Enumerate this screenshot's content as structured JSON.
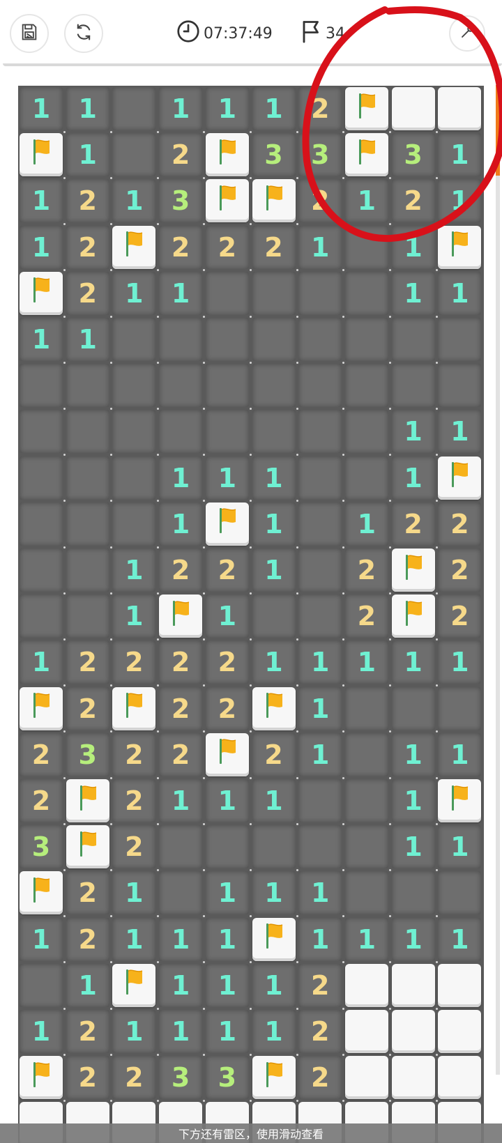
{
  "toolbar": {
    "timer": "07:37:49",
    "flag_count": "34",
    "icons": [
      "save-icon",
      "restart-icon",
      "clock-icon",
      "flag-icon",
      "tool-icon"
    ]
  },
  "colors": {
    "one": "#6ff0d2",
    "two": "#f6d98a",
    "three": "#b6ee7c",
    "flag": "#f7b21b",
    "accent": "#f07a1a",
    "annotation": "#d8111a"
  },
  "board": {
    "rows": [
      [
        "1",
        "1",
        "",
        "1",
        "1",
        "1",
        "2",
        "F",
        "C",
        "C"
      ],
      [
        "F",
        "1",
        "",
        "2",
        "F",
        "3",
        "3",
        "F",
        "3",
        "1"
      ],
      [
        "1",
        "2",
        "1",
        "3",
        "F",
        "F",
        "2",
        "1",
        "2",
        "1"
      ],
      [
        "1",
        "2",
        "F",
        "2",
        "2",
        "2",
        "1",
        "",
        "1",
        "F"
      ],
      [
        "F",
        "2",
        "1",
        "1",
        "",
        "",
        "",
        "",
        "1",
        "1"
      ],
      [
        "1",
        "1",
        "",
        "",
        "",
        "",
        "",
        "",
        "",
        ""
      ],
      [
        "",
        "",
        "",
        "",
        "",
        "",
        "",
        "",
        "",
        ""
      ],
      [
        "",
        "",
        "",
        "",
        "",
        "",
        "",
        "",
        "1",
        "1"
      ],
      [
        "",
        "",
        "",
        "1",
        "1",
        "1",
        "",
        "",
        "1",
        "F"
      ],
      [
        "",
        "",
        "",
        "1",
        "F",
        "1",
        "",
        "1",
        "2",
        "2"
      ],
      [
        "",
        "",
        "1",
        "2",
        "2",
        "1",
        "",
        "2",
        "F",
        "2"
      ],
      [
        "",
        "",
        "1",
        "F",
        "1",
        "",
        "",
        "2",
        "F",
        "2"
      ],
      [
        "1",
        "2",
        "2",
        "2",
        "2",
        "1",
        "1",
        "1",
        "1",
        "1"
      ],
      [
        "F",
        "2",
        "F",
        "2",
        "2",
        "F",
        "1",
        "",
        "",
        ""
      ],
      [
        "2",
        "3",
        "2",
        "2",
        "F",
        "2",
        "1",
        "",
        "1",
        "1"
      ],
      [
        "2",
        "F",
        "2",
        "1",
        "1",
        "1",
        "",
        "",
        "1",
        "F"
      ],
      [
        "3",
        "F",
        "2",
        "",
        "",
        "",
        "",
        "",
        "1",
        "1"
      ],
      [
        "F",
        "2",
        "1",
        "",
        "1",
        "1",
        "1",
        "",
        "",
        ""
      ],
      [
        "1",
        "2",
        "1",
        "1",
        "1",
        "F",
        "1",
        "1",
        "1",
        "1"
      ],
      [
        "",
        "1",
        "F",
        "1",
        "1",
        "1",
        "2",
        "C",
        "C",
        "C"
      ],
      [
        "1",
        "2",
        "1",
        "1",
        "1",
        "1",
        "2",
        "C",
        "C",
        "C"
      ],
      [
        "F",
        "2",
        "2",
        "3",
        "3",
        "F",
        "2",
        "C",
        "C",
        "C"
      ],
      [
        "C",
        "C",
        "C",
        "C",
        "C",
        "C",
        "C",
        "C",
        "C",
        "C"
      ]
    ]
  },
  "footer": {
    "hint": "下方还有雷区，使用滑动查看"
  }
}
